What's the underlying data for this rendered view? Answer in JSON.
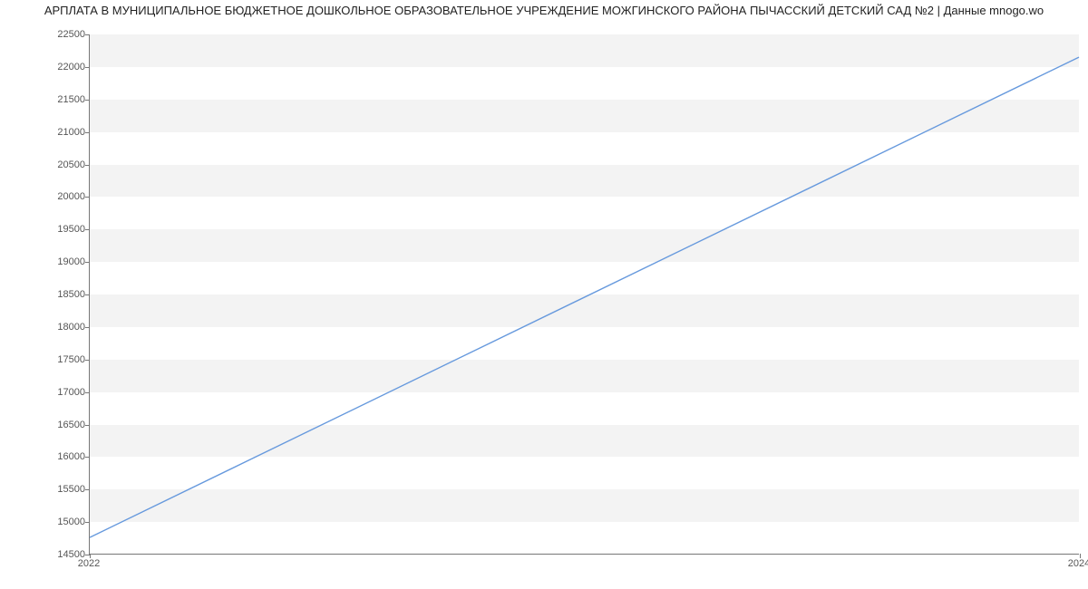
{
  "chart_data": {
    "type": "line",
    "title": "АРПЛАТА В МУНИЦИПАЛЬНОЕ БЮДЖЕТНОЕ ДОШКОЛЬНОЕ ОБРАЗОВАТЕЛЬНОЕ УЧРЕЖДЕНИЕ МОЖГИНСКОГО РАЙОНА ПЫЧАССКИЙ ДЕТСКИЙ САД №2 | Данные mnogo.wo",
    "xlabel": "",
    "ylabel": "",
    "x": [
      2022,
      2024
    ],
    "values": [
      14750,
      22150
    ],
    "xlim": [
      2022,
      2024
    ],
    "ylim": [
      14500,
      22500
    ],
    "y_ticks": [
      14500,
      15000,
      15500,
      16000,
      16500,
      17000,
      17500,
      18000,
      18500,
      19000,
      19500,
      20000,
      20500,
      21000,
      21500,
      22000,
      22500
    ],
    "x_ticks": [
      2022,
      2024
    ],
    "line_color": "#6699dd"
  }
}
